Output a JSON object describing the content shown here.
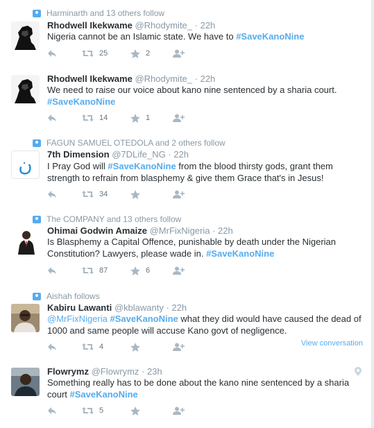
{
  "tweets": [
    {
      "context": "Harminarth and 13 others follow",
      "fullname": "Rhodwell Ikekwame",
      "username": "@Rhodymite_",
      "time": "· 22h",
      "text_before": "Nigeria cannot be an Islamic state. We have to ",
      "hashtag": "#SaveKanoNine",
      "retweets": "25",
      "favorites": "2"
    },
    {
      "context": "",
      "fullname": "Rhodwell Ikekwame",
      "username": "@Rhodymite_",
      "time": "· 22h",
      "text_before": "We need to raise our voice about kano nine sentenced by a sharia court.",
      "hashtag": "#SaveKanoNine",
      "retweets": "14",
      "favorites": "1"
    },
    {
      "context": "FAGUN SAMUEL OTEDOLA and 2 others follow",
      "fullname": "7th Dimension",
      "username": "@7DLife_NG",
      "time": "· 22h",
      "text_before": "I Pray God will ",
      "hashtag": "#SaveKanoNine",
      "text_after": " from the blood thirsty gods, grant them strength to refrain from blasphemy & give them Grace that's in Jesus!",
      "avatar_glyph": "ن",
      "retweets": "34",
      "favorites": ""
    },
    {
      "context": "The COMPANY and 13 others follow",
      "fullname": "Ohimai Godwin Amaize",
      "username": "@MrFixNigeria",
      "time": "· 22h",
      "text_before": "Is Blasphemy a Capital Offence, punishable by death under the Nigerian Constitution? Lawyers, please wade in. ",
      "hashtag": "#SaveKanoNine",
      "retweets": "87",
      "favorites": "6"
    },
    {
      "context": "Aishah follows",
      "fullname": "Kabiru Lawanti",
      "username": "@kblawanty",
      "time": "· 22h",
      "mention": "@MrFixNigeria",
      "hashtag": "#SaveKanoNine",
      "text_after": " what they did would have caused the dead of 1000 and same people will accuse Kano govt of negligence.",
      "retweets": "4",
      "favorites": "",
      "view_conversation": "View conversation"
    },
    {
      "context": "",
      "fullname": "Flowrymz",
      "username": "@Flowrymz",
      "time": "· 23h",
      "text_before": "Something really has to be done about the kano nine sentenced by a sharia court ",
      "hashtag": "#SaveKanoNine",
      "retweets": "5",
      "favorites": ""
    }
  ],
  "icons": {
    "reply": "reply-icon",
    "retweet": "retweet-icon",
    "favorite": "star-icon",
    "follow": "follow-icon",
    "context": "person-icon",
    "geo": "location-pin-icon"
  },
  "colors": {
    "link": "#55acee",
    "meta": "#8899a6",
    "text": "#292f33"
  }
}
